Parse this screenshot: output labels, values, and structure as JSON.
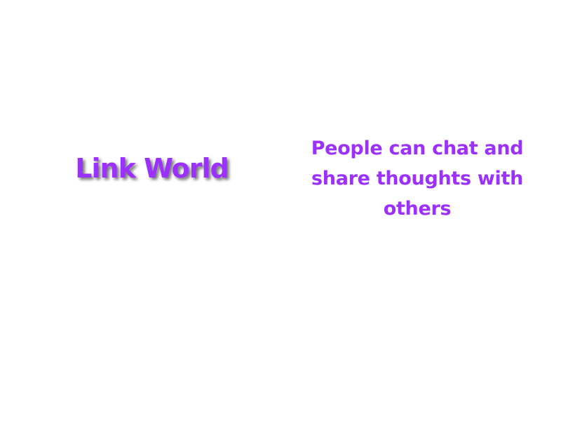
{
  "brand": {
    "name": "Link World",
    "tagline": "People can chat and share thoughts with others"
  },
  "colors": {
    "accent": "#9b30ff",
    "background": "#ffffff"
  }
}
